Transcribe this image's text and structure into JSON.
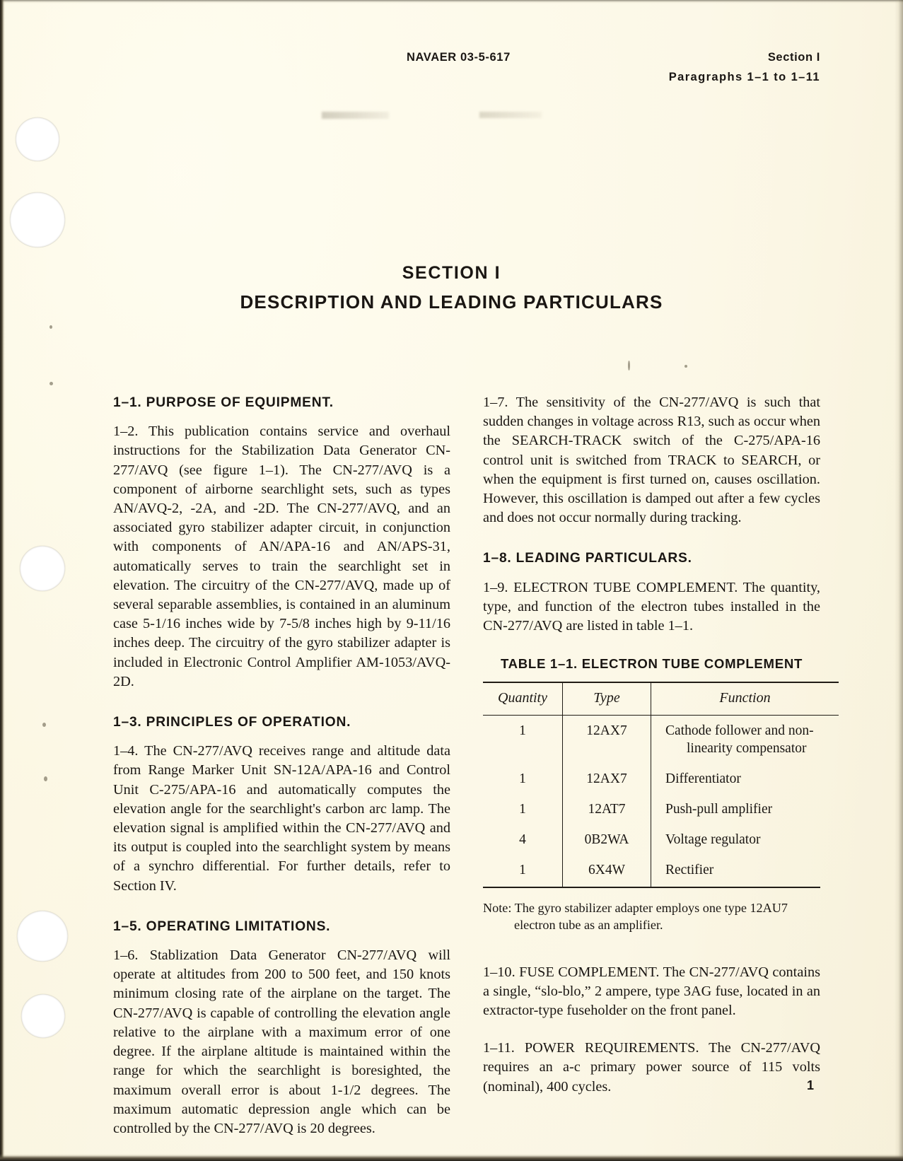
{
  "document": {
    "running_head": {
      "left": "NAVAER 03-5-617",
      "right_line1": "Section I",
      "right_line2": "Paragraphs 1–1 to 1–11"
    },
    "section_title": "SECTION I",
    "section_subtitle": "DESCRIPTION AND LEADING PARTICULARS",
    "page_number": "1"
  },
  "left_column": {
    "heading_1_1": "1–1. PURPOSE OF EQUIPMENT.",
    "para_1_2": "1–2. This publication contains service and overhaul instructions for the Stabilization Data Generator CN-277/AVQ (see figure 1–1). The CN-277/AVQ is a component of airborne searchlight sets, such as types AN/AVQ-2, -2A, and -2D. The CN-277/AVQ, and an associated gyro stabilizer adapter circuit, in conjunction with components of AN/APA-16 and AN/APS-31, automatically serves to train the searchlight set in elevation. The circuitry of the CN-277/AVQ, made up of several separable assemblies, is contained in an aluminum case 5-1/16 inches wide by 7-5/8 inches high by 9-11/16 inches deep. The circuitry of the gyro stabilizer adapter is included in Electronic Control Amplifier AM-1053/AVQ-2D.",
    "heading_1_3": "1–3. PRINCIPLES OF OPERATION.",
    "para_1_4": "1–4. The CN-277/AVQ receives range and altitude data from Range Marker Unit SN-12A/APA-16 and Control Unit C-275/APA-16 and automatically computes the elevation angle for the searchlight's carbon arc lamp. The elevation signal is amplified within the CN-277/AVQ and its output is coupled into the searchlight system by means of a synchro differential. For further details, refer to Section IV.",
    "heading_1_5": "1–5. OPERATING LIMITATIONS.",
    "para_1_6": "1–6. Stablization Data Generator CN-277/AVQ will operate at altitudes from 200 to 500 feet, and 150 knots minimum closing rate of the airplane on the target. The CN-277/AVQ is capable of controlling the elevation angle relative to the airplane with a maximum error of one degree. If the airplane altitude is maintained within the range for which the searchlight is boresighted, the maximum overall error is about 1-1/2 degrees. The maximum automatic depression angle which can be controlled by the CN-277/AVQ is 20 degrees."
  },
  "right_column": {
    "para_1_7": "1–7. The sensitivity of the CN-277/AVQ is such that sudden changes in voltage across R13, such as occur when the SEARCH-TRACK switch of the C-275/APA-16 control unit is switched from TRACK to SEARCH, or when the equipment is first turned on, causes oscillation. However, this oscillation is damped out after a few cycles and does not occur normally during tracking.",
    "heading_1_8": "1–8. LEADING PARTICULARS.",
    "para_1_9": "1–9. ELECTRON TUBE COMPLEMENT. The quantity, type, and function of the electron tubes installed in the CN-277/AVQ are listed in table 1–1.",
    "table_caption": "TABLE 1–1. ELECTRON TUBE COMPLEMENT",
    "table": {
      "headers": [
        "Quantity",
        "Type",
        "Function"
      ],
      "rows": [
        {
          "quantity": "1",
          "type": "12AX7",
          "function_line1": "Cathode follower and non-",
          "function_line2": "linearity compensator"
        },
        {
          "quantity": "1",
          "type": "12AX7",
          "function_line1": "Differentiator",
          "function_line2": ""
        },
        {
          "quantity": "1",
          "type": "12AT7",
          "function_line1": "Push-pull amplifier",
          "function_line2": ""
        },
        {
          "quantity": "4",
          "type": "0B2WA",
          "function_line1": "Voltage regulator",
          "function_line2": ""
        },
        {
          "quantity": "1",
          "type": "6X4W",
          "function_line1": "Rectifier",
          "function_line2": ""
        }
      ]
    },
    "note_line1": "Note: The gyro stabilizer adapter employs one type 12AU7",
    "note_line2": "electron tube as an amplifier.",
    "para_1_10": "1–10. FUSE COMPLEMENT. The CN-277/AVQ contains a single, “slo-blo,” 2 ampere, type 3AG fuse, located in an extractor-type fuseholder on the front panel.",
    "para_1_11": "1–11. POWER REQUIREMENTS. The CN-277/AVQ requires an a-c primary power source of 115 volts (nominal), 400 cycles."
  }
}
